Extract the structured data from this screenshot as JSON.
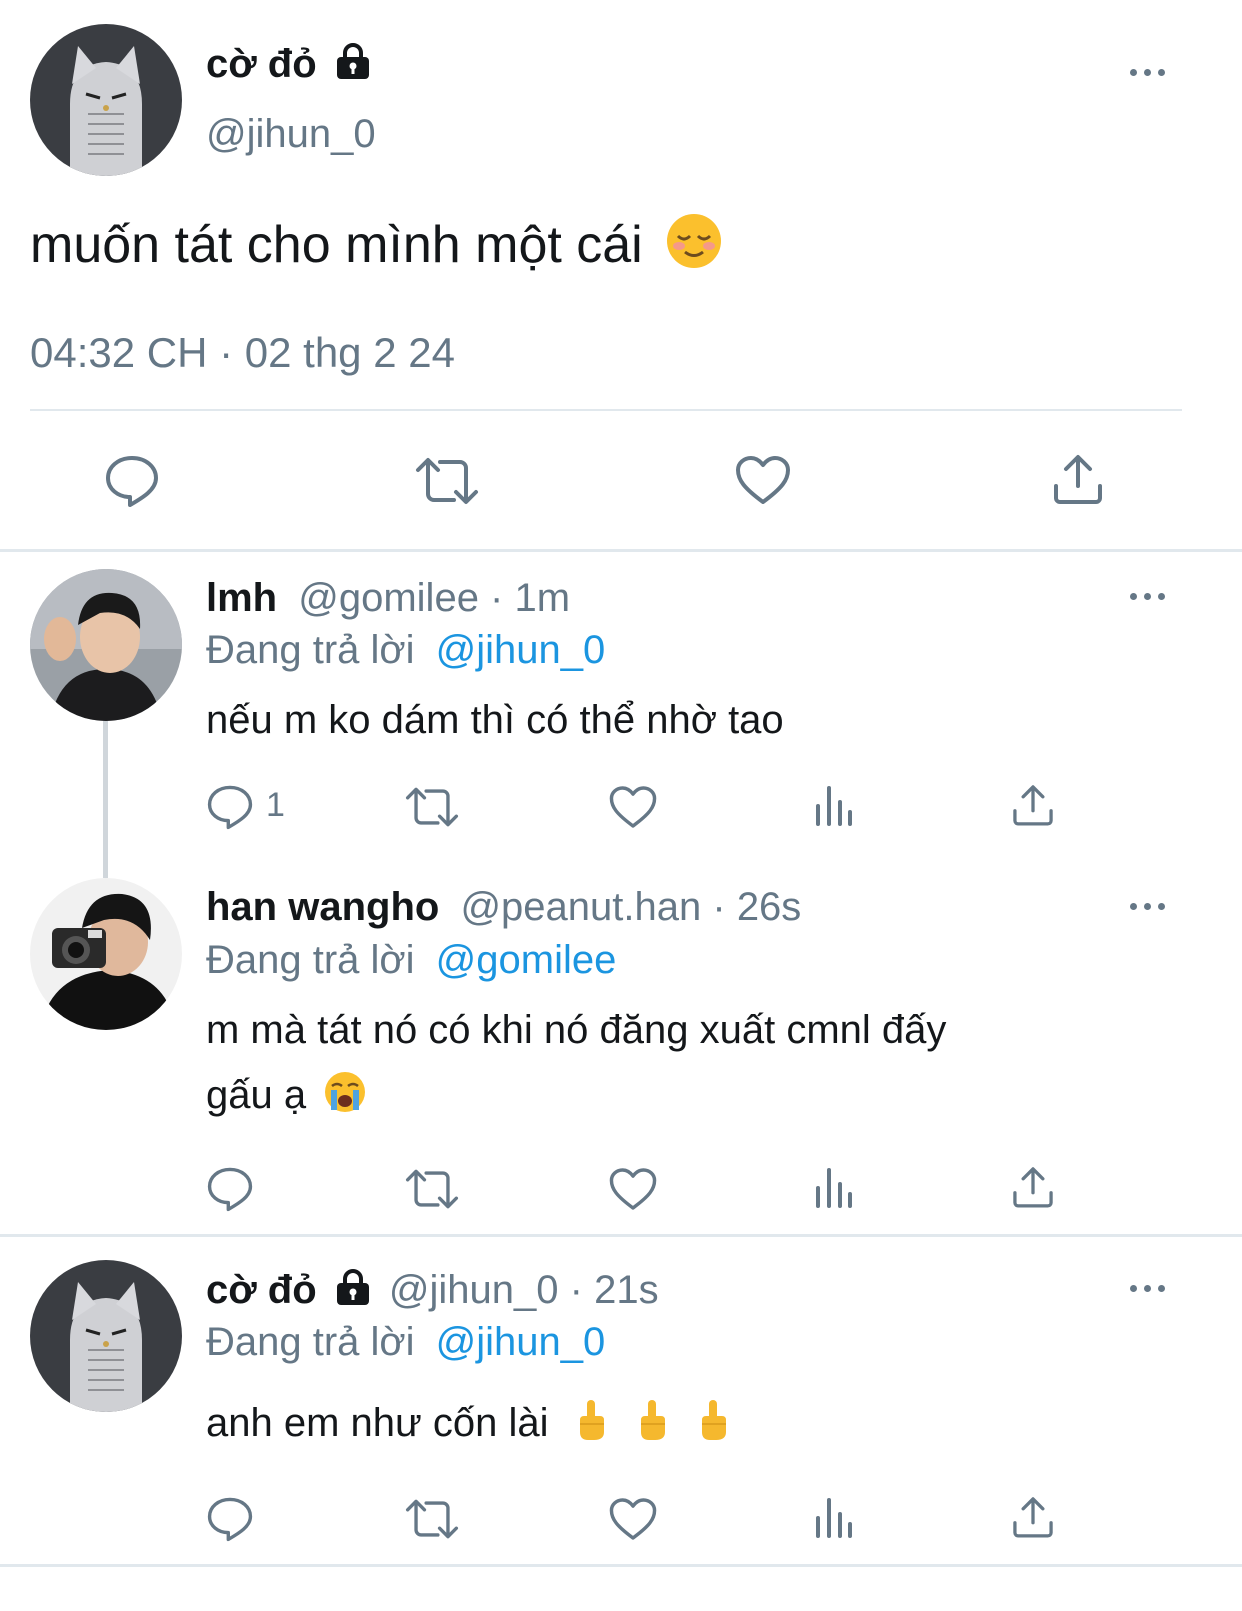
{
  "main_tweet": {
    "display_name": "cờ đỏ",
    "handle": "@jihun_0",
    "text": "muốn tát cho mình một cái",
    "timestamp": "04:32 CH · 02 thg 2 24",
    "icons": [
      "lock-icon",
      "more-icon",
      "reply-icon",
      "retweet-icon",
      "like-icon",
      "share-icon"
    ]
  },
  "replies": [
    {
      "display_name": "lmh",
      "handle": "@gomilee",
      "time": " · 1m",
      "replying_prefix": "Đang trả lời",
      "replying_to": "@jihun_0",
      "text": "nếu m ko dám thì có thể nhờ tao",
      "reply_count": "1"
    },
    {
      "display_name": "han wangho",
      "handle": "@peanut.han",
      "time": " · 26s",
      "replying_prefix": "Đang trả lời",
      "replying_to": "@gomilee",
      "text_line1": "m mà tát nó có khi nó đăng xuất cmnl đấy",
      "text_line2": "gấu ạ",
      "reply_count": ""
    },
    {
      "display_name": "cờ đỏ",
      "handle": "@jihun_0",
      "time": " · 21s",
      "replying_prefix": "Đang trả lời",
      "replying_to": "@jihun_0",
      "text": "anh em như cốn lài",
      "reply_count": ""
    }
  ],
  "colors": {
    "text": "#14171a",
    "secondary": "#657786",
    "link": "#1b95e0",
    "divider": "#e1e8ed"
  }
}
